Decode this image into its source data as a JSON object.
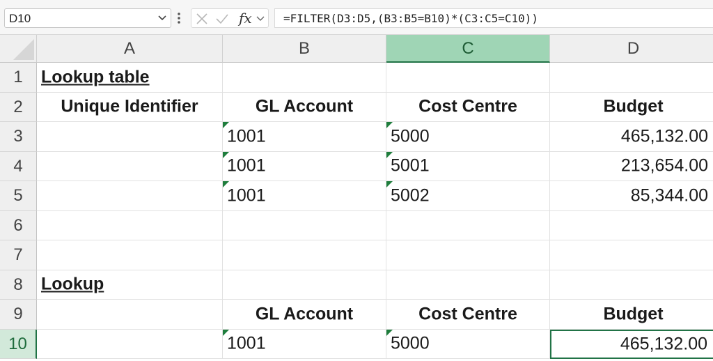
{
  "name_box": {
    "value": "D10",
    "chevron_icon": "chevron-down-icon"
  },
  "formula_bar": {
    "cancel_icon": "x-icon",
    "enter_icon": "check-icon",
    "fx_label": "fx",
    "formula": "=FILTER(D3:D5,(B3:B5=B10)*(C3:C5=C10))"
  },
  "columns": [
    {
      "label": "A",
      "active": false
    },
    {
      "label": "B",
      "active": false
    },
    {
      "label": "C",
      "active": true
    },
    {
      "label": "D",
      "active": false
    }
  ],
  "rows": [
    "1",
    "2",
    "3",
    "4",
    "5",
    "6",
    "7",
    "8",
    "9",
    "10"
  ],
  "active_row": "10",
  "cells": {
    "A1": "Lookup table",
    "A2": "Unique Identifier",
    "B2": "GL Account",
    "C2": "Cost Centre",
    "D2": "Budget",
    "B3": "1001",
    "C3": "5000",
    "D3": "465,132.00",
    "B4": "1001",
    "C4": "5001",
    "D4": "213,654.00",
    "B5": "1001",
    "C5": "5002",
    "D5": "85,344.00",
    "A8": "Lookup",
    "B9": "GL Account",
    "C9": "Cost Centre",
    "D9": "Budget",
    "B10": "1001",
    "C10": "5000",
    "D10": "465,132.00"
  },
  "colors": {
    "accent_green": "#217346",
    "number_as_text_flag": "#1e7d3c"
  }
}
